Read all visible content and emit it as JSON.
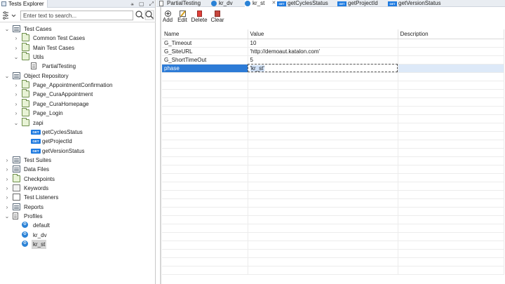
{
  "explorer": {
    "tab_title": "Tests Explorer",
    "tab_actions": [
      "⚹",
      "▢",
      "⤢"
    ],
    "search_placeholder": "Enter text to search...",
    "filter_icon": "filter-icon",
    "search_icon": "search-icon",
    "advanced_search_icon": "advanced-search-icon"
  },
  "tree": {
    "nodes": [
      {
        "label": "Test Cases",
        "icon": "test-cases-root-icon",
        "expanded": true,
        "level": 0
      },
      {
        "label": "Common Test Cases",
        "icon": "folder-icon",
        "expanded": false,
        "level": 1
      },
      {
        "label": "Main Test Cases",
        "icon": "folder-icon",
        "expanded": false,
        "level": 1
      },
      {
        "label": "Utils",
        "icon": "folder-icon",
        "expanded": true,
        "level": 1
      },
      {
        "label": "PartialTesting",
        "icon": "test-case-icon",
        "level": 2
      },
      {
        "label": "Object Repository",
        "icon": "object-repository-icon",
        "expanded": true,
        "level": 0
      },
      {
        "label": "Page_AppointmentConfirmation",
        "icon": "folder-icon",
        "expanded": false,
        "level": 1
      },
      {
        "label": "Page_CuraAppointment",
        "icon": "folder-icon",
        "expanded": false,
        "level": 1
      },
      {
        "label": "Page_CuraHomepage",
        "icon": "folder-icon",
        "expanded": false,
        "level": 1
      },
      {
        "label": "Page_Login",
        "icon": "folder-icon",
        "expanded": false,
        "level": 1
      },
      {
        "label": "zapi",
        "icon": "folder-icon",
        "expanded": true,
        "level": 1
      },
      {
        "label": "getCyclesStatus",
        "icon": "get-request-icon",
        "badge": "GET",
        "level": 2
      },
      {
        "label": "getProjectId",
        "icon": "get-request-icon",
        "badge": "GET",
        "level": 2
      },
      {
        "label": "getVersionStatus",
        "icon": "get-request-icon",
        "badge": "GET",
        "level": 2
      },
      {
        "label": "Test Suites",
        "icon": "test-suites-icon",
        "expanded": false,
        "level": 0
      },
      {
        "label": "Data Files",
        "icon": "data-files-icon",
        "expanded": false,
        "level": 0
      },
      {
        "label": "Checkpoints",
        "icon": "checkpoints-icon",
        "expanded": false,
        "level": 0
      },
      {
        "label": "Keywords",
        "icon": "keywords-icon",
        "expanded": false,
        "level": 0
      },
      {
        "label": "Test Listeners",
        "icon": "test-listeners-icon",
        "expanded": false,
        "level": 0
      },
      {
        "label": "Reports",
        "icon": "reports-icon",
        "expanded": false,
        "level": 0
      },
      {
        "label": "Profiles",
        "icon": "profiles-icon",
        "expanded": true,
        "level": 0
      },
      {
        "label": "default",
        "icon": "profile-icon",
        "level": 1
      },
      {
        "label": "kr_dv",
        "icon": "profile-icon",
        "level": 1
      },
      {
        "label": "kr_st",
        "icon": "profile-icon",
        "level": 1,
        "selected": true
      }
    ]
  },
  "editor_tabs": [
    {
      "label": "PartialTesting",
      "icon": "test-case-icon"
    },
    {
      "label": "kr_dv",
      "icon": "profile-icon"
    },
    {
      "label": "kr_st",
      "icon": "profile-icon",
      "active": true,
      "closable": true
    },
    {
      "label": "getCyclesStatus",
      "icon": "get-request-icon",
      "badge": "GET"
    },
    {
      "label": "getProjectId",
      "icon": "get-request-icon",
      "badge": "GET"
    },
    {
      "label": "getVersionStatus",
      "icon": "get-request-icon",
      "badge": "GET"
    }
  ],
  "toolbar": {
    "add_label": "Add",
    "edit_label": "Edit",
    "delete_label": "Delete",
    "clear_label": "Clear"
  },
  "variables": {
    "columns": [
      "Name",
      "Value",
      "Description"
    ],
    "rows": [
      {
        "name": "G_Timeout",
        "value": "10",
        "description": ""
      },
      {
        "name": "G_SiteURL",
        "value": "'http://demoaut.katalon.com'",
        "description": ""
      },
      {
        "name": "G_ShortTimeOut",
        "value": "5",
        "description": ""
      },
      {
        "name": "phase",
        "value": "'kr_st'",
        "description": "",
        "selected": true
      }
    ]
  }
}
